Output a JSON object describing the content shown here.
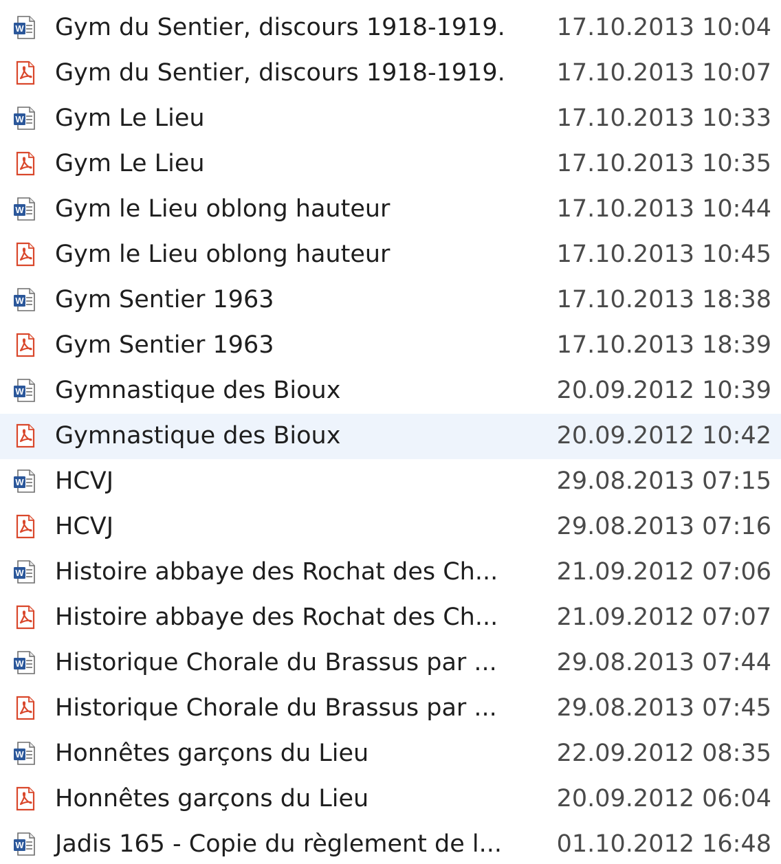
{
  "colors": {
    "word_icon": "#2b579a",
    "pdf_icon": "#d9472b",
    "hover_row": "#eef4fc"
  },
  "files": [
    {
      "name": "Gym du Sentier, discours 1918-1919.",
      "modified": "17.10.2013 10:04",
      "icon": "word-icon"
    },
    {
      "name": "Gym du Sentier, discours 1918-1919.",
      "modified": "17.10.2013 10:07",
      "icon": "pdf-icon"
    },
    {
      "name": "Gym Le Lieu",
      "modified": "17.10.2013 10:33",
      "icon": "word-icon"
    },
    {
      "name": "Gym Le Lieu",
      "modified": "17.10.2013 10:35",
      "icon": "pdf-icon"
    },
    {
      "name": "Gym le Lieu oblong hauteur",
      "modified": "17.10.2013 10:44",
      "icon": "word-icon"
    },
    {
      "name": "Gym le Lieu oblong hauteur",
      "modified": "17.10.2013 10:45",
      "icon": "pdf-icon"
    },
    {
      "name": "Gym Sentier 1963",
      "modified": "17.10.2013 18:38",
      "icon": "word-icon"
    },
    {
      "name": "Gym Sentier 1963",
      "modified": "17.10.2013 18:39",
      "icon": "pdf-icon"
    },
    {
      "name": "Gymnastique des Bioux",
      "modified": "20.09.2012 10:39",
      "icon": "word-icon"
    },
    {
      "name": "Gymnastique des Bioux",
      "modified": "20.09.2012 10:42",
      "icon": "pdf-icon",
      "hovered": true
    },
    {
      "name": "HCVJ",
      "modified": "29.08.2013 07:15",
      "icon": "word-icon"
    },
    {
      "name": "HCVJ",
      "modified": "29.08.2013 07:16",
      "icon": "pdf-icon"
    },
    {
      "name": "Histoire abbaye des Rochat des Ch...",
      "modified": "21.09.2012 07:06",
      "icon": "word-icon"
    },
    {
      "name": "Histoire abbaye des Rochat des Ch...",
      "modified": "21.09.2012 07:07",
      "icon": "pdf-icon"
    },
    {
      "name": "Historique Chorale du Brassus par ...",
      "modified": "29.08.2013 07:44",
      "icon": "word-icon"
    },
    {
      "name": "Historique Chorale du Brassus par ...",
      "modified": "29.08.2013 07:45",
      "icon": "pdf-icon"
    },
    {
      "name": "Honnêtes garçons du Lieu",
      "modified": "22.09.2012 08:35",
      "icon": "word-icon"
    },
    {
      "name": "Honnêtes garçons du Lieu",
      "modified": "20.09.2012 06:04",
      "icon": "pdf-icon"
    },
    {
      "name": "Jadis 165 - Copie du règlement de l...",
      "modified": "01.10.2012 16:48",
      "icon": "word-icon"
    }
  ]
}
